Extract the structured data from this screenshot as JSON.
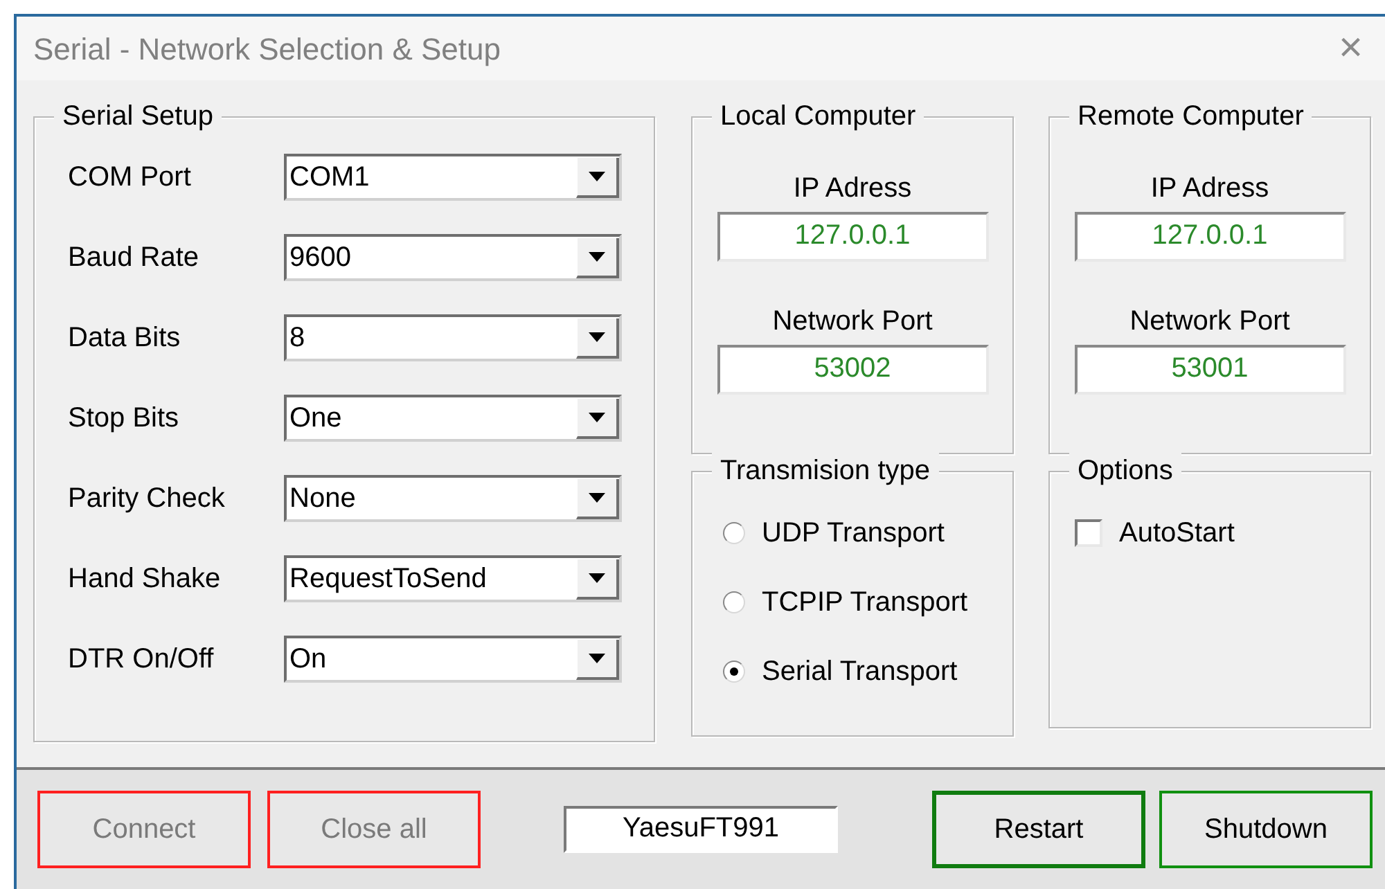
{
  "window": {
    "title": "Serial - Network  Selection & Setup",
    "close": "×"
  },
  "serial_setup": {
    "title": "Serial Setup",
    "fields": [
      {
        "label": "COM Port",
        "value": "COM1"
      },
      {
        "label": "Baud Rate",
        "value": "9600"
      },
      {
        "label": "Data Bits",
        "value": "8"
      },
      {
        "label": "Stop Bits",
        "value": "One"
      },
      {
        "label": "Parity Check",
        "value": "None"
      },
      {
        "label": "Hand Shake",
        "value": "RequestToSend"
      },
      {
        "label": "DTR On/Off",
        "value": "On"
      }
    ]
  },
  "computers": [
    {
      "title": "Local Computer",
      "ip_label": "IP Adress",
      "ip": "127.0.0.1",
      "port_label": "Network Port",
      "port": "53002"
    },
    {
      "title": "Remote Computer",
      "ip_label": "IP Adress",
      "ip": "127.0.0.1",
      "port_label": "Network Port",
      "port": "53001"
    }
  ],
  "transmission": {
    "title": "Transmision type",
    "options": [
      {
        "label": "UDP Transport",
        "selected": false
      },
      {
        "label": "TCPIP Transport",
        "selected": false
      },
      {
        "label": "Serial Transport",
        "selected": true
      }
    ]
  },
  "options": {
    "title": "Options",
    "items": [
      {
        "label": "AutoStart",
        "checked": false
      }
    ]
  },
  "footer": {
    "buttons_left": [
      {
        "label": "Connect",
        "disabled": true,
        "color": "#ff2020",
        "focused": false
      },
      {
        "label": "Close all",
        "disabled": true,
        "color": "#ff2020",
        "focused": false
      }
    ],
    "device": "YaesuFT991",
    "buttons_right": [
      {
        "label": "Restart",
        "disabled": false,
        "color": "#107c10",
        "focused": true
      },
      {
        "label": "Shutdown",
        "disabled": false,
        "color": "#109010",
        "focused": false
      }
    ]
  }
}
